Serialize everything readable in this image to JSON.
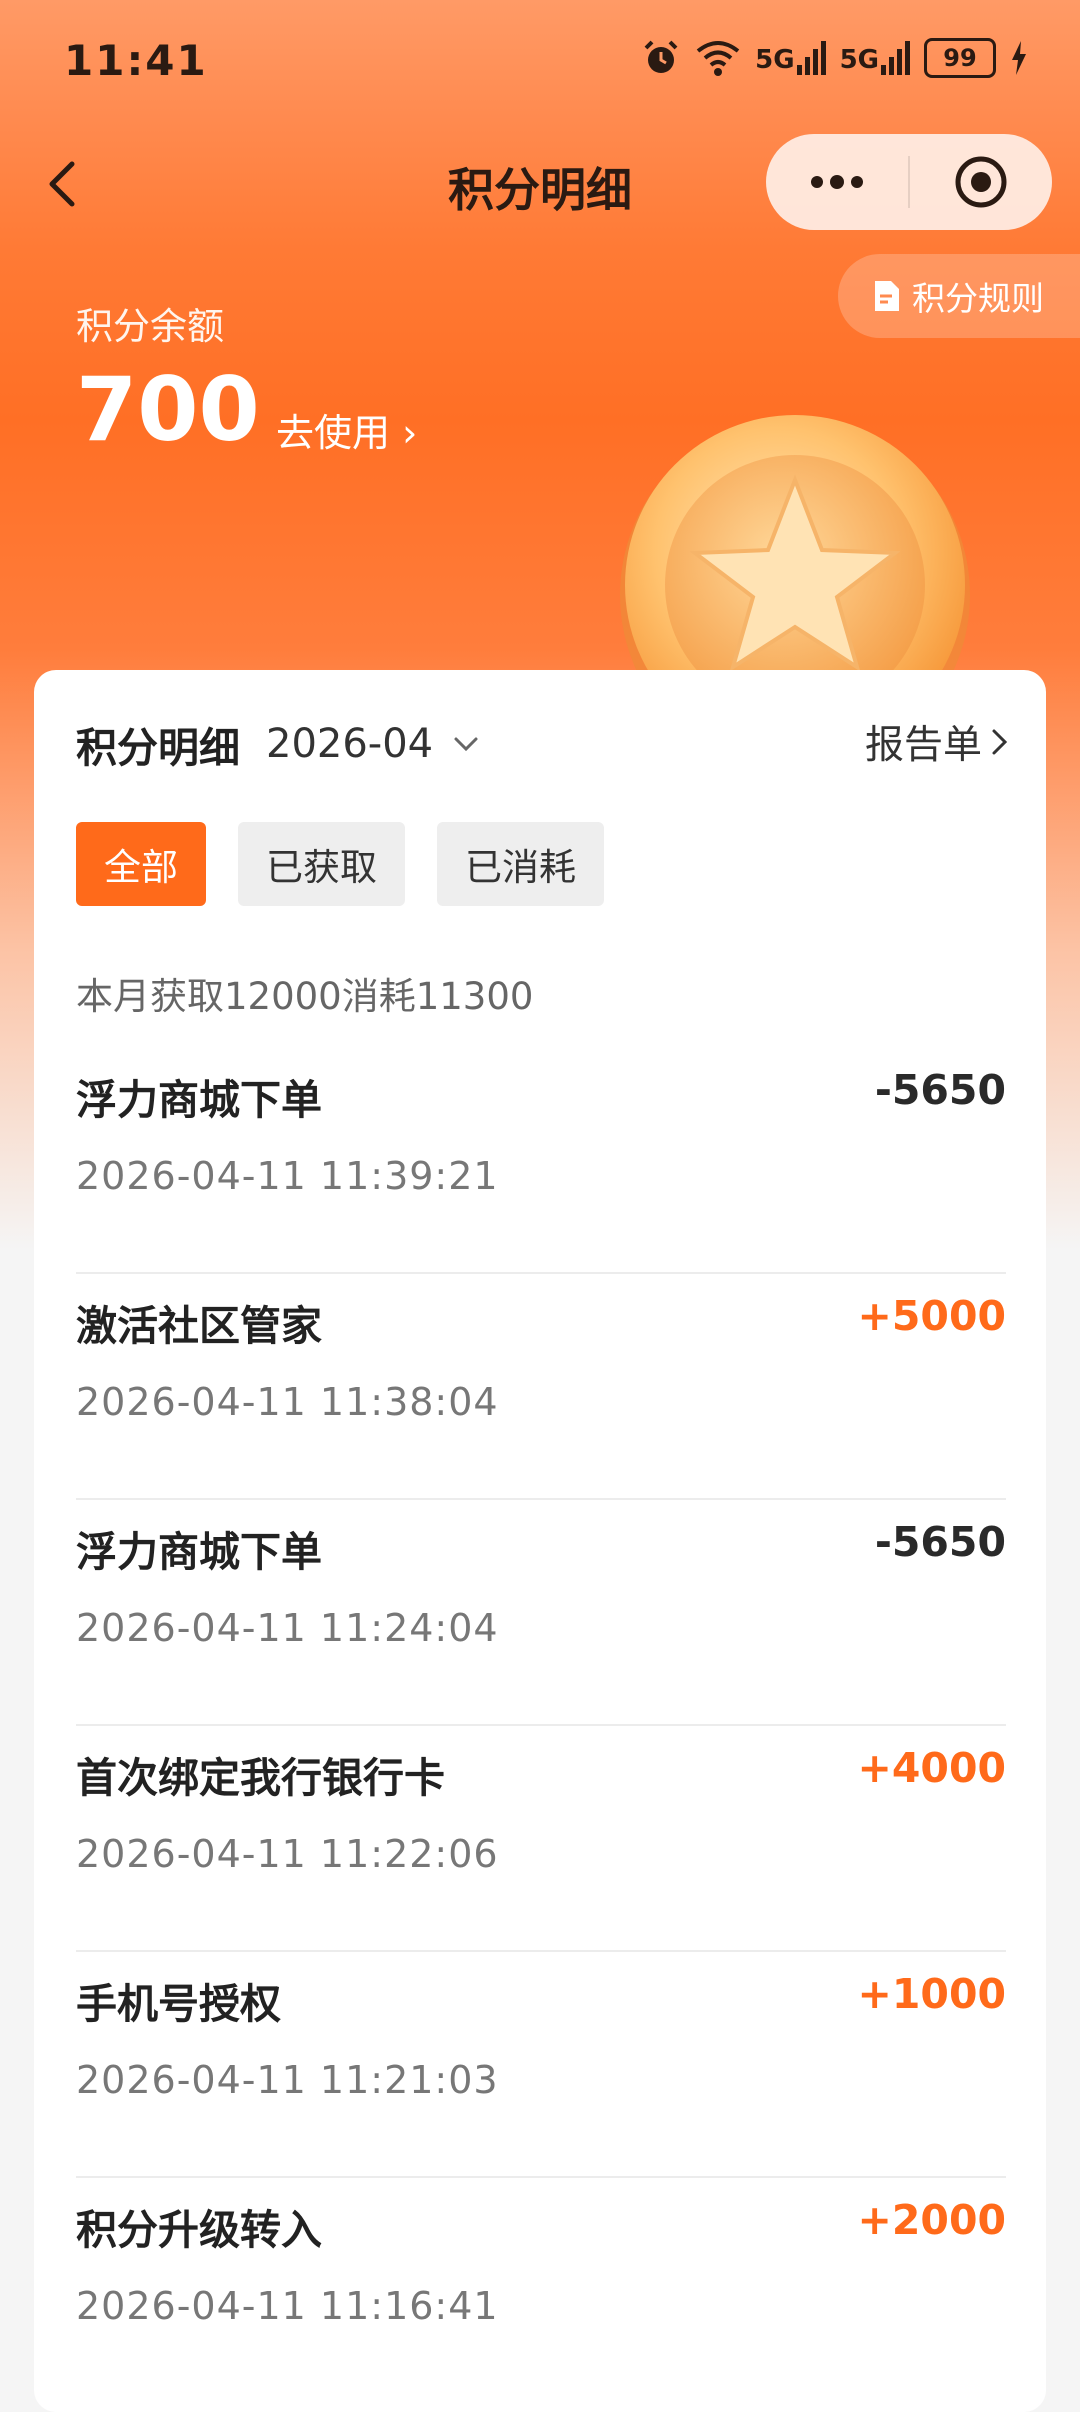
{
  "status_bar": {
    "time": "11:41",
    "network_1": "5G",
    "network_2": "5G",
    "battery": "99"
  },
  "nav": {
    "title": "积分明细"
  },
  "header": {
    "rules_label": "积分规则",
    "balance_label": "积分余额",
    "balance_value": "700",
    "use_label": "去使用 ›"
  },
  "card": {
    "title": "积分明细",
    "month": "2026-04",
    "report_label": "报告单",
    "filters": [
      "全部",
      "已获取",
      "已消耗"
    ],
    "summary": "本月获取12000消耗11300",
    "items": [
      {
        "title": "浮力商城下单",
        "date": "2026-04-11 11:39:21",
        "amount": "-5650",
        "type": "neg"
      },
      {
        "title": "激活社区管家",
        "date": "2026-04-11 11:38:04",
        "amount": "+5000",
        "type": "pos"
      },
      {
        "title": "浮力商城下单",
        "date": "2026-04-11 11:24:04",
        "amount": "-5650",
        "type": "neg"
      },
      {
        "title": "首次绑定我行银行卡",
        "date": "2026-04-11 11:22:06",
        "amount": "+4000",
        "type": "pos"
      },
      {
        "title": "手机号授权",
        "date": "2026-04-11 11:21:03",
        "amount": "+1000",
        "type": "pos"
      },
      {
        "title": "积分升级转入",
        "date": "2026-04-11 11:16:41",
        "amount": "+2000",
        "type": "pos"
      }
    ]
  },
  "colors": {
    "accent": "#ff6a1a",
    "negative": "#2a2a2a"
  },
  "icons": [
    "alarm-icon",
    "wifi-icon",
    "signal-icon",
    "battery-icon",
    "charging-icon",
    "back-icon",
    "more-icon",
    "target-icon",
    "document-icon",
    "chevron-down-icon",
    "chevron-right-icon",
    "coin-star-icon"
  ]
}
